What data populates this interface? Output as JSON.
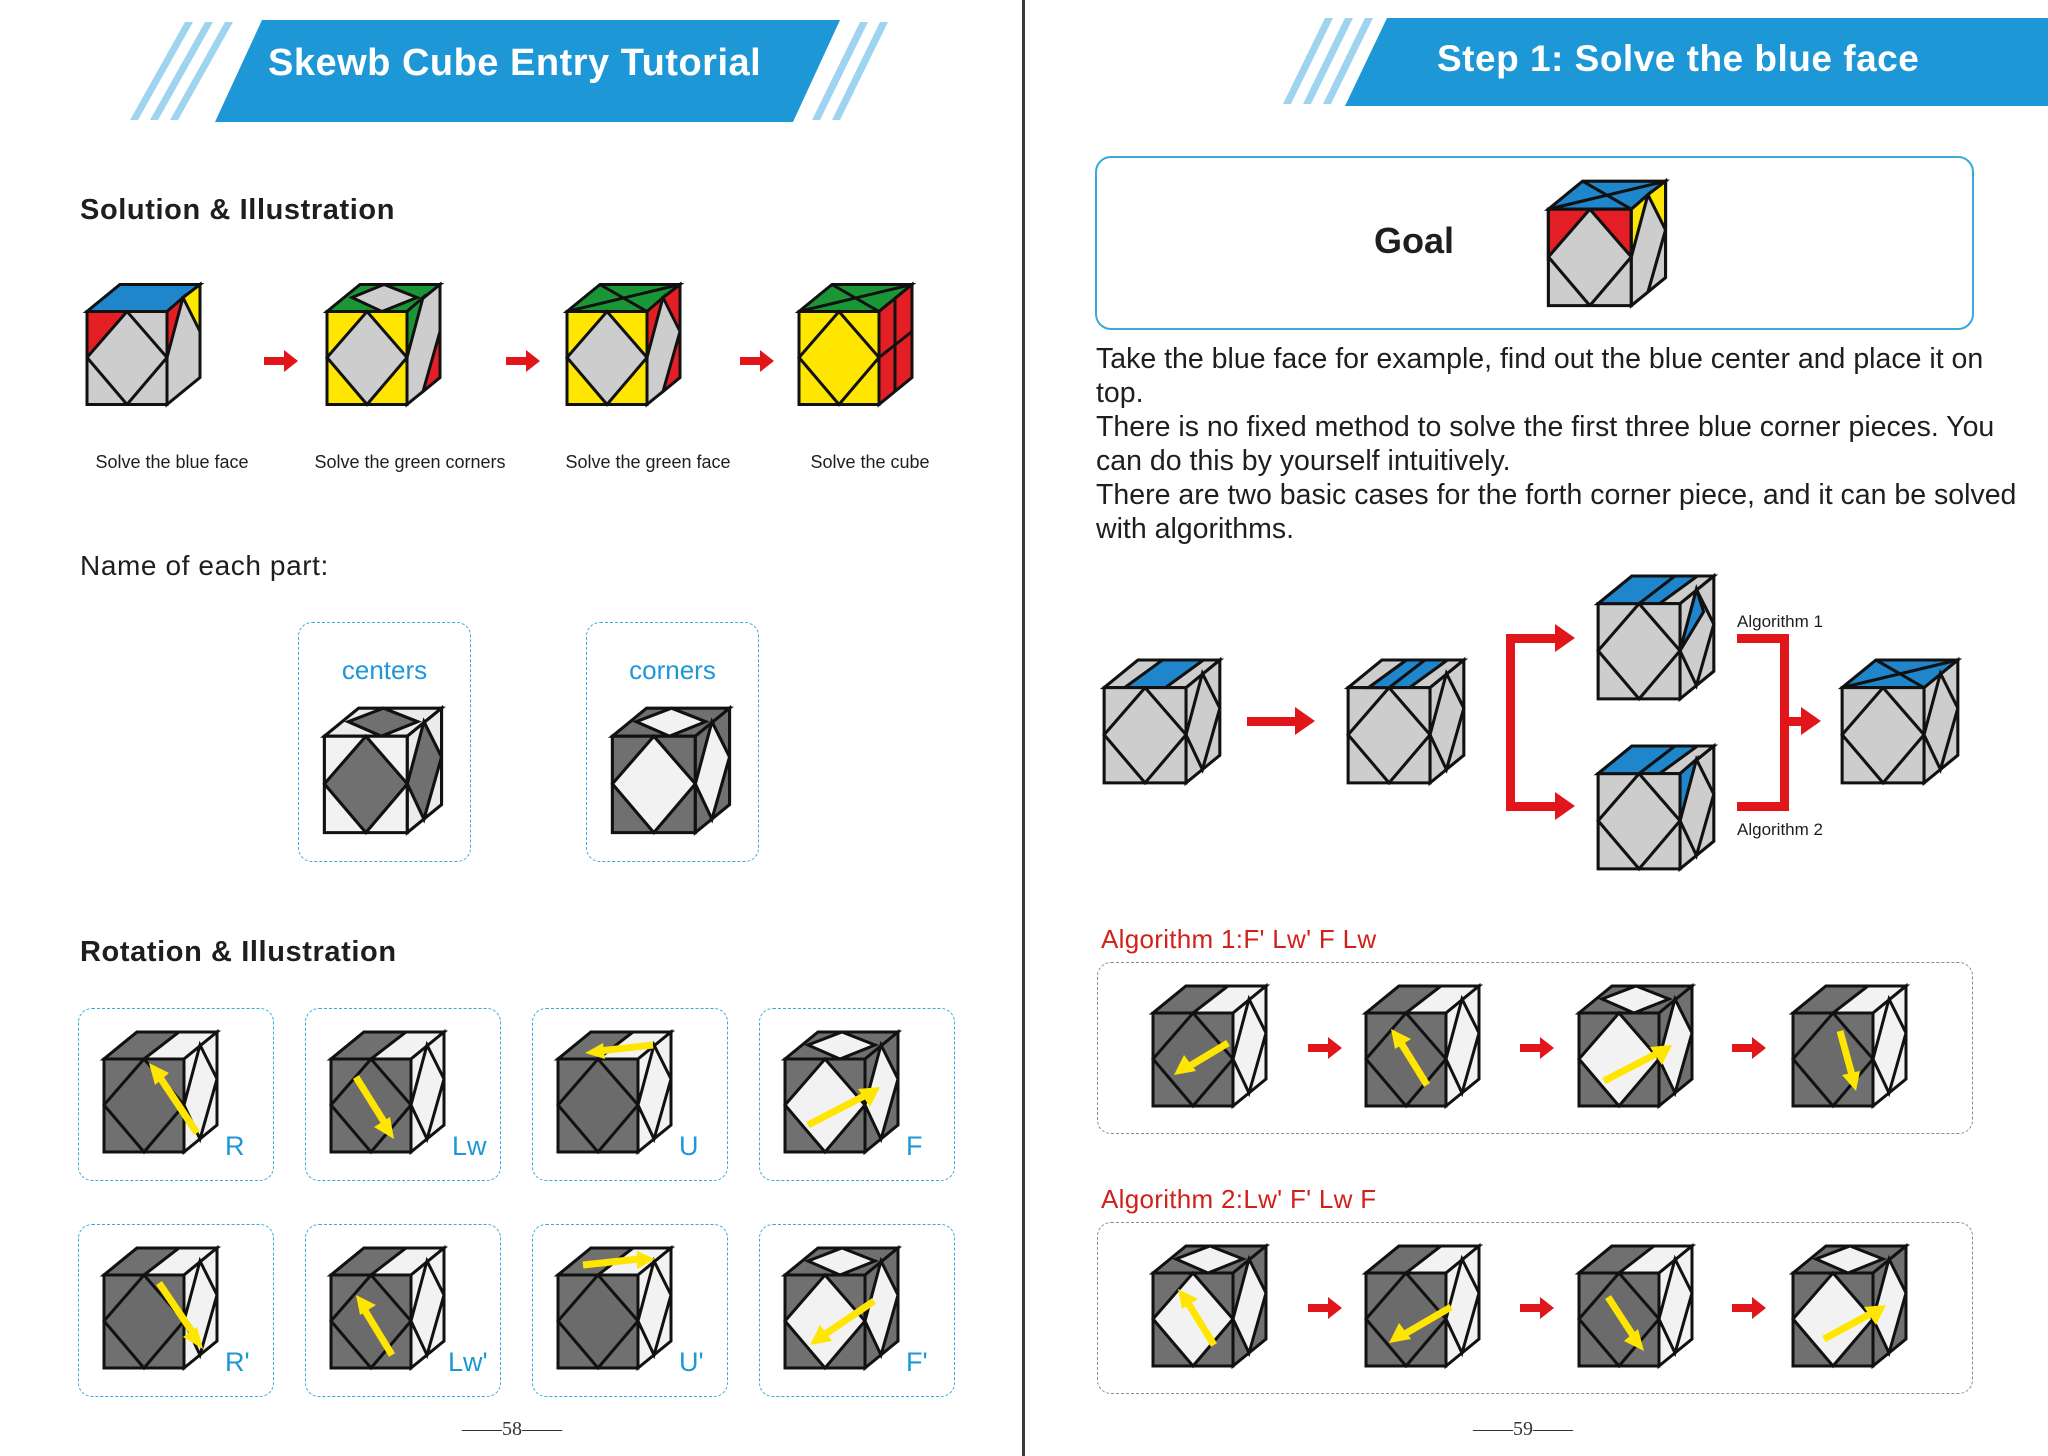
{
  "left_page": {
    "banner_title": "Skewb Cube Entry Tutorial",
    "solution_heading": "Solution & Illustration",
    "solution_steps": [
      {
        "caption": "Solve the blue face",
        "cube_icon": "cube-blue-top-icon"
      },
      {
        "caption": "Solve the green corners",
        "cube_icon": "cube-green-corners-icon"
      },
      {
        "caption": "Solve the green face",
        "cube_icon": "cube-green-face-icon"
      },
      {
        "caption": "Solve the cube",
        "cube_icon": "cube-solved-icon"
      }
    ],
    "parts_heading": "Name of each part:",
    "parts": [
      {
        "label": "centers"
      },
      {
        "label": "corners"
      }
    ],
    "rotation_heading": "Rotation & Illustration",
    "rotations": [
      {
        "label": "R"
      },
      {
        "label": "Lw"
      },
      {
        "label": "U"
      },
      {
        "label": "F"
      },
      {
        "label": "R'"
      },
      {
        "label": "Lw'"
      },
      {
        "label": "U'"
      },
      {
        "label": "F'"
      }
    ],
    "page_number": "——58——"
  },
  "right_page": {
    "banner_title": "Step 1: Solve the blue face",
    "goal_label": "Goal",
    "paragraphs": [
      "Take the blue face for example, find out the blue center and place it on top.",
      "There is no fixed method to solve the first three blue corner pieces. You can do this by yourself intuitively.",
      "There are two basic cases for the forth corner piece, and it can be solved with algorithms."
    ],
    "branch_labels": [
      "Algorithm 1",
      "Algorithm 2"
    ],
    "algorithm1_heading": "Algorithm 1:F'   Lw'  F Lw",
    "algorithm2_heading": "Algorithm 2:Lw'   F'  Lw F",
    "page_number": "——59——"
  },
  "colors": {
    "banner_blue": "#1d97d6",
    "accent_red": "#e0161b",
    "sticker_blue": "#1f86cc",
    "sticker_red": "#e31e24",
    "sticker_yellow": "#ffe600",
    "sticker_green": "#1b9636",
    "sticker_gray": "#cdcdcd",
    "dark_gray": "#6b6b6b",
    "arrow_yellow": "#ffe600"
  }
}
